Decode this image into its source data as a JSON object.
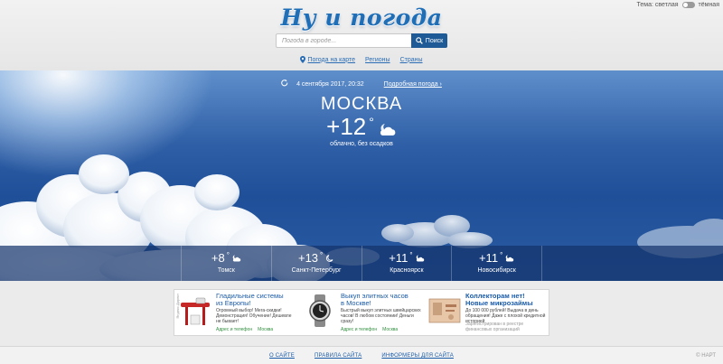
{
  "header": {
    "logo": "Ну и погода",
    "theme_light": "Тема: светлая",
    "theme_dark": "тёмная",
    "search_placeholder": "Погода в городе...",
    "search_button": "Поиск",
    "nav": [
      {
        "label": "Погода на карте",
        "icon": "map-pin-icon"
      },
      {
        "label": "Регионы"
      },
      {
        "label": "Страны"
      }
    ]
  },
  "hero": {
    "updated": "4 сентября 2017, 20:32",
    "detail_link": "Подробная погода ›",
    "city": "МОСКВА",
    "temperature": "+12",
    "degree": "°",
    "condition_icon": "partly-cloudy-night-icon",
    "condition": "облачно, без осадков",
    "cities": [
      {
        "temp": "+8",
        "name": "Томск",
        "icon": "partly-cloudy-night-icon"
      },
      {
        "temp": "+13",
        "name": "Санкт-Петербург",
        "icon": "moon-icon"
      },
      {
        "temp": "+11",
        "name": "Красноярск",
        "icon": "partly-cloudy-night-icon"
      },
      {
        "temp": "+11",
        "name": "Новосибирск",
        "icon": "partly-cloudy-night-icon"
      }
    ]
  },
  "ads": [
    {
      "tag": "Яндекс.Директ",
      "title": "Гладильные системы",
      "title2": "из Европы!",
      "text": "Огромный выбор! Мега-скидки! Демонстрация! Обучение! Дешевле не бывает!",
      "foot_1": "Адрес и телефон",
      "foot_2": "Москва"
    },
    {
      "title": "Выкуп элитных часов",
      "title2": "в Москве!",
      "text": "Быстрый выкуп элитных швейцарских часов! В любом состоянии! Деньги сразу!",
      "foot_1": "Адрес и телефон",
      "foot_2": "Москва"
    },
    {
      "title": "Коллекторам нет! Новые микрозаймы",
      "title2": "",
      "text": "До 100 000 рублей! Выдача в день обращения! Даже с плохой кредитной историей",
      "foot_1": "Зарегистрирован в реестре финансовых организаций",
      "foot_2": ""
    }
  ],
  "footer": {
    "links": [
      "О САЙТЕ",
      "ПРАВИЛА САЙТА",
      "ИНФОРМЕРЫ ДЛЯ САЙТА"
    ],
    "copyright": "© НАРТ"
  },
  "colors": {
    "logo": "#1e6fb8",
    "search_button": "#1d5a96",
    "link": "#2a6db5",
    "sky_dark": "#1f4f98"
  }
}
